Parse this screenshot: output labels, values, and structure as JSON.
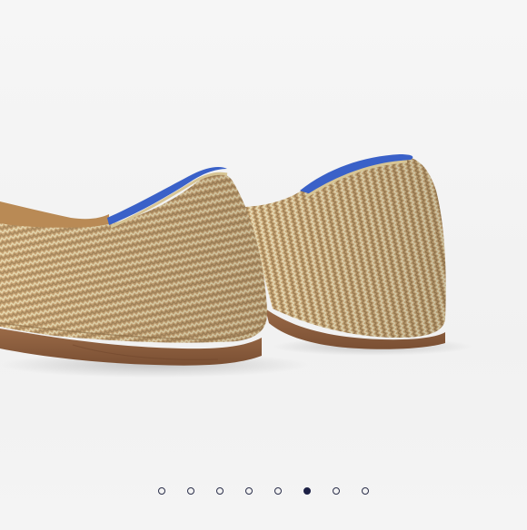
{
  "carousel": {
    "image": {
      "subject": "knit-flat-shoes-heel-view",
      "palette": {
        "knit_base": "#c9a77a",
        "knit_stripe_light": "#e3d3a6",
        "knit_stripe_dark": "#9a7a4f",
        "metallic_thread": "#d8d6b8",
        "collar_band": "#3c63c9",
        "sole": "#8a5e3f",
        "background": "#f3f3f3"
      }
    },
    "slide_count": 8,
    "active_index": 5,
    "colors": {
      "dot_outline": "#2b2f4a",
      "dot_active": "#1c2145"
    }
  }
}
